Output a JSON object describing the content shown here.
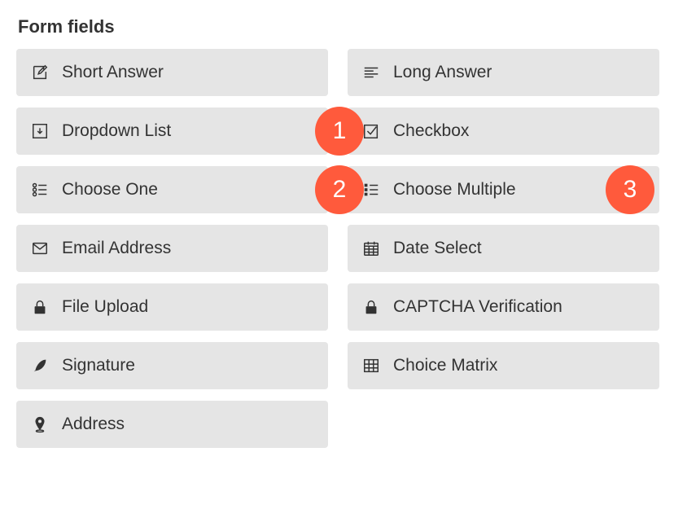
{
  "section_title": "Form fields",
  "fields": {
    "short_answer": "Short Answer",
    "long_answer": "Long Answer",
    "dropdown_list": "Dropdown List",
    "checkbox": "Checkbox",
    "choose_one": "Choose One",
    "choose_multiple": "Choose Multiple",
    "email_address": "Email Address",
    "date_select": "Date Select",
    "file_upload": "File Upload",
    "captcha": "CAPTCHA Verification",
    "signature": "Signature",
    "choice_matrix": "Choice Matrix",
    "address": "Address"
  },
  "annotations": {
    "a1": "1",
    "a2": "2",
    "a3": "3"
  }
}
